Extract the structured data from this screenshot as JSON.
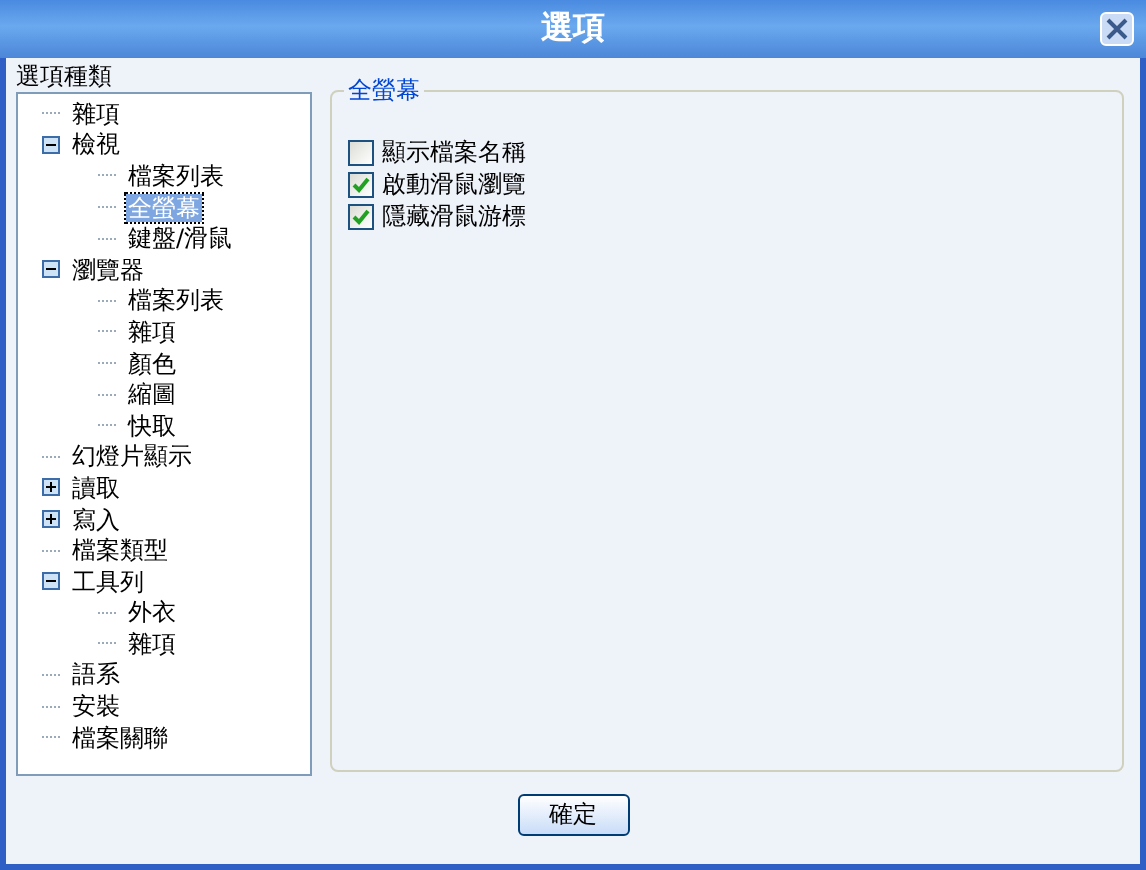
{
  "window": {
    "title": "選項"
  },
  "category_label": "選項種類",
  "tree": [
    {
      "label": "雜項",
      "selected": false
    },
    {
      "label": "檢視",
      "selected": false,
      "expanded": true,
      "children": [
        {
          "label": "檔案列表",
          "selected": false
        },
        {
          "label": "全螢幕",
          "selected": true
        },
        {
          "label": "鍵盤/滑鼠",
          "selected": false
        }
      ]
    },
    {
      "label": "瀏覽器",
      "selected": false,
      "expanded": true,
      "children": [
        {
          "label": "檔案列表",
          "selected": false
        },
        {
          "label": "雜項",
          "selected": false
        },
        {
          "label": "顏色",
          "selected": false
        },
        {
          "label": "縮圖",
          "selected": false
        },
        {
          "label": "快取",
          "selected": false
        }
      ]
    },
    {
      "label": "幻燈片顯示",
      "selected": false
    },
    {
      "label": "讀取",
      "selected": false,
      "expanded": false
    },
    {
      "label": "寫入",
      "selected": false,
      "expanded": false
    },
    {
      "label": "檔案類型",
      "selected": false
    },
    {
      "label": "工具列",
      "selected": false,
      "expanded": true,
      "children": [
        {
          "label": "外衣",
          "selected": false
        },
        {
          "label": "雜項",
          "selected": false
        }
      ]
    },
    {
      "label": "語系",
      "selected": false
    },
    {
      "label": "安裝",
      "selected": false
    },
    {
      "label": "檔案關聯",
      "selected": false
    }
  ],
  "group": {
    "title": "全螢幕",
    "options": [
      {
        "label": "顯示檔案名稱",
        "checked": false
      },
      {
        "label": "啟動滑鼠瀏覽",
        "checked": true
      },
      {
        "label": "隱藏滑鼠游標",
        "checked": true
      }
    ]
  },
  "ok_button": "確定"
}
